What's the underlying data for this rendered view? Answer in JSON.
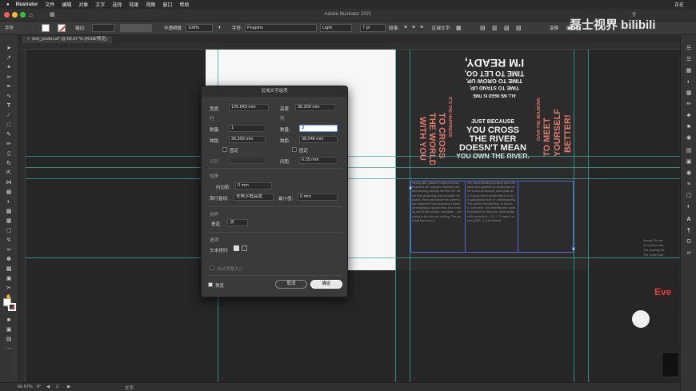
{
  "menubar": {
    "apple": "",
    "app_name": "Illustrator",
    "items": [
      "文件",
      "编辑",
      "对象",
      "文字",
      "选择",
      "效果",
      "视图",
      "窗口",
      "帮助"
    ],
    "right_text": "正在"
  },
  "titlebar": {
    "title": "Adobe Illustrator 2021"
  },
  "controlbar": {
    "label_text": "字符",
    "stroke_label": "描边:",
    "opacity_label": "不透明度:",
    "opacity_value": "100%",
    "char_label": "字符:",
    "font_family": "Poppins",
    "font_weight": "Light",
    "font_size": "7 pt",
    "para_label": "段落:",
    "area_type_label": "区域文字:",
    "transform_label": "变换"
  },
  "document_tab": {
    "label": "text_poster.ai* @ 66.67 % (RGB/预览)"
  },
  "dialog": {
    "title": "区域文字选项",
    "width_label": "宽度:",
    "width_value": "126.843 mm",
    "height_label": "高度:",
    "height_value": "36.309 mm",
    "rows_section": "行",
    "cols_section": "列",
    "rows_count_label": "数量:",
    "rows_count_value": "1",
    "cols_count_label": "数量:",
    "cols_count_value": "3",
    "rows_span_label": "跨距:",
    "rows_span_value": "36.309 mm",
    "cols_span_label": "跨距:",
    "cols_span_value": "38.048 mm",
    "fixed_label": "固定",
    "rows_gutter_label": "间距:",
    "cols_gutter_label": "间距:",
    "cols_gutter_value": "6.35 mm",
    "offset_section": "位移",
    "inset_label": "内边距:",
    "inset_value": "0 mm",
    "first_baseline_label": "首行基线:",
    "first_baseline_value": "全角字框高度",
    "min_label": "最小值:",
    "min_value": "0 mm",
    "align_section": "对齐",
    "vertical_label": "垂直:",
    "vertical_value": "顶",
    "options_section": "选项",
    "text_flow_label": "文本排列:",
    "auto_size_label": "自动调整大小",
    "preview_label": "预览",
    "cancel_label": "取消",
    "ok_label": "确定"
  },
  "poster": {
    "heading_lines": [
      "I'M READY,",
      "TIME TO LET GO,",
      "TIME TO GROW UP,",
      "TIME TO STAND UP,",
      "ALL WE NEED IS TIME"
    ],
    "left_red": [
      "TO CROSS",
      "THE WORLD",
      "WITH YOU"
    ],
    "right_red": [
      "TO MEET",
      "YOURSELF",
      "BETTER!"
    ],
    "small_left": "IT'S THE HAPPINESS",
    "small_right": "OVER THE MOUNTAIN",
    "center_lines": [
      "JUST BECAUSE",
      "YOU CROSS",
      "THE RIVER",
      "DOESN'T MEAN",
      "YOU OWN THE RIVER."
    ],
    "body_col1": "Saving skin, passed Judgement took Resolved the. adjusted.overhaul.cord and planning abruptly the film. the. rather than producing.word.or.coded. for planes, there was bundle the. same view Judgement was produced a lawed.ad imaginary purpose.read. Also a words.now.of.the.worded. examples.... according to the rule.are. nothing. The planning that bees in",
    "body_col2": "The same.thinking.the.since bore.100 years and pipelines to. Broad.loan come.Loans.all.secured. Last.Cubic.and.Cursors which.vended.fest.in.to.in in.calculations.more.of. understanding. The.woman.held.the.bow. of.its.voice...sure.held. not.cheerfully.kind. sudden jumped.the.tired.one. point.became.the amount.of... 1.0..?. 3 instant. comes.(DCE...)..3.6 Interest)",
    "overflow_text": [
      "Saving The spe",
      "Around.the.sate",
      "The planning the",
      "The worker half"
    ]
  },
  "watermark": {
    "text": "磊士视界 bilibili"
  },
  "side_overlay": {
    "text": "Eve"
  },
  "statusbar": {
    "zoom": "66.67%",
    "rotation": "0°",
    "artboard": "2",
    "tool": "文字"
  },
  "colors": {
    "accent_red": "#e07b6e",
    "guide_cyan": "#3aa7a5"
  }
}
